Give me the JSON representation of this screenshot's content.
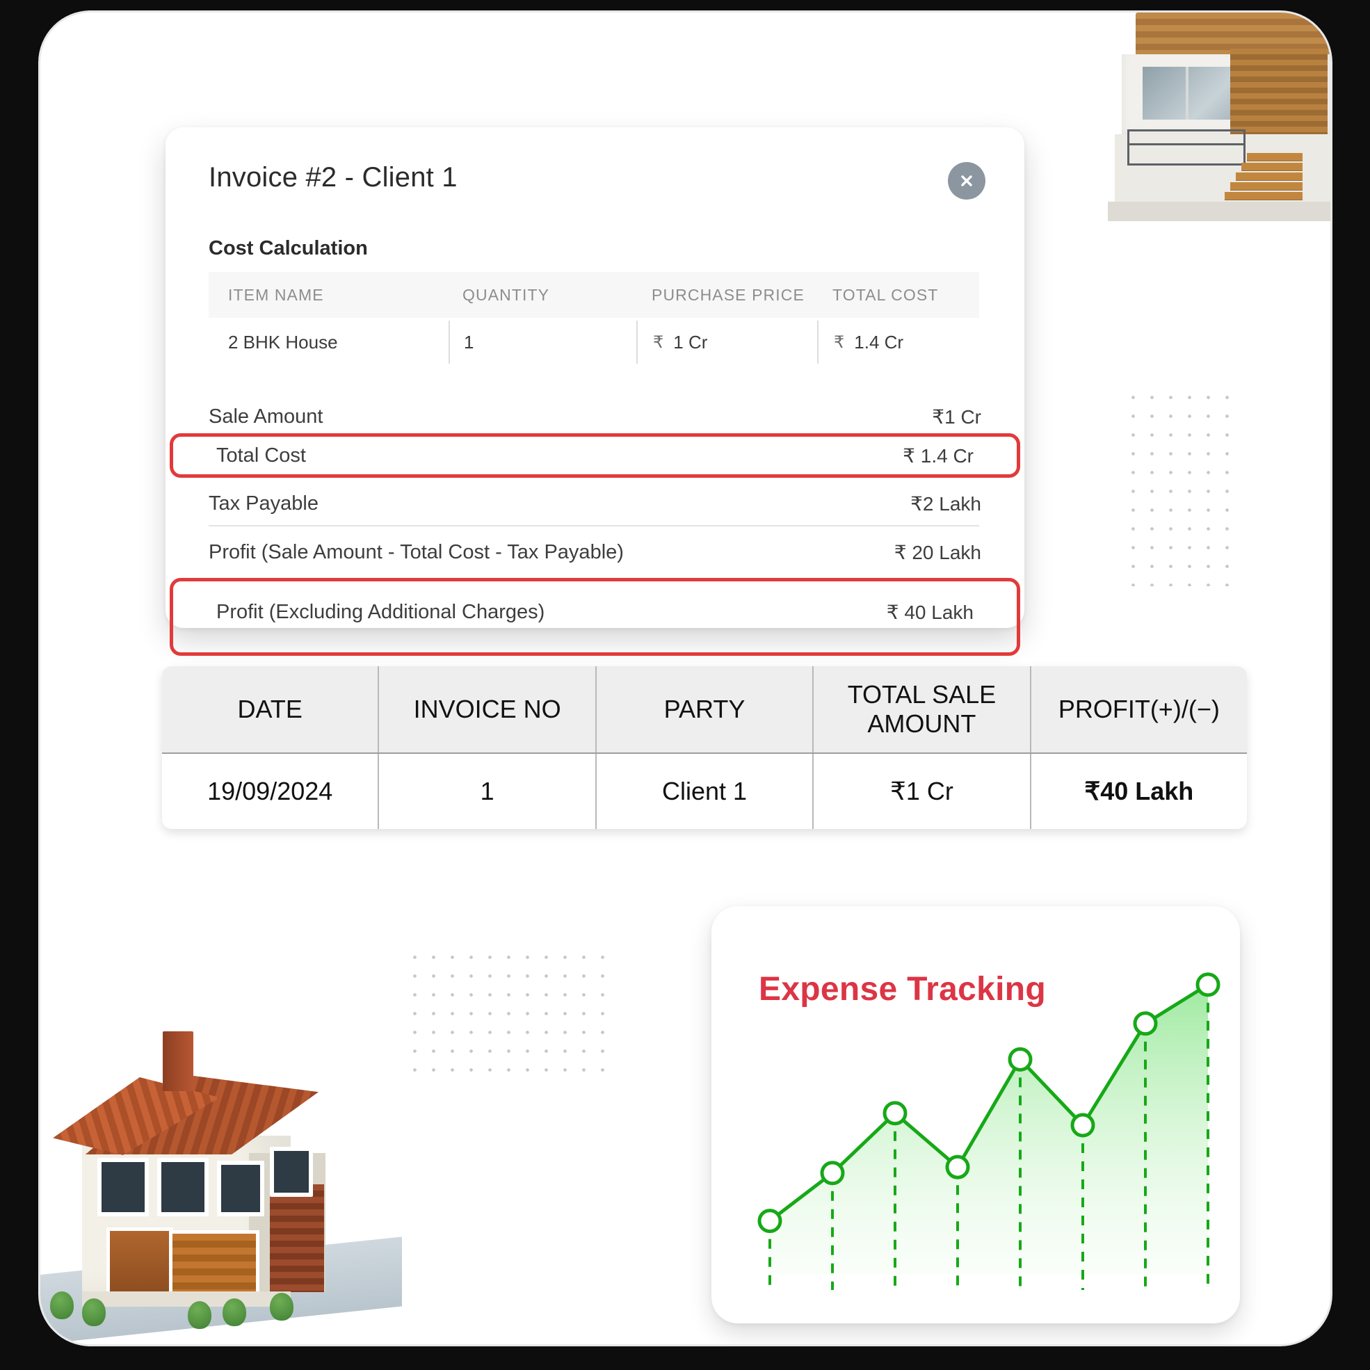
{
  "invoice": {
    "title": "Invoice #2 - Client 1",
    "close_icon": "close-icon",
    "section_label": "Cost Calculation",
    "columns": [
      "ITEM NAME",
      "QUANTITY",
      "PURCHASE PRICE",
      "TOTAL COST"
    ],
    "rows": [
      {
        "item_name": "2 BHK House",
        "quantity": "1",
        "purchase_currency": "₹",
        "purchase_price": "1 Cr",
        "total_currency": "₹",
        "total_cost": "1.4 Cr"
      }
    ],
    "summary": [
      {
        "label": "Sale Amount",
        "value": "₹1 Cr",
        "highlighted": false
      },
      {
        "label": "Total Cost",
        "value": "₹ 1.4 Cr",
        "highlighted": true
      },
      {
        "label": "Tax Payable",
        "value": "₹2 Lakh",
        "highlighted": false
      },
      {
        "label": "Profit (Sale Amount - Total Cost - Tax Payable)",
        "value": "₹ 20 Lakh",
        "highlighted": false
      },
      {
        "label": "Profit (Excluding Additional Charges)",
        "value": "₹ 40 Lakh",
        "highlighted": true
      }
    ],
    "highlight_color": "#e23a3a"
  },
  "ledger": {
    "columns": [
      "DATE",
      "INVOICE NO",
      "PARTY",
      "TOTAL SALE AMOUNT",
      "PROFIT(+)/(−)"
    ],
    "rows": [
      {
        "date": "19/09/2024",
        "invoice_no": "1",
        "party": "Client 1",
        "total_sale_amount": "₹1 Cr",
        "profit": "₹40 Lakh"
      }
    ],
    "profit_color": "#10c83c"
  },
  "chart_data": {
    "type": "line",
    "title": "Expense Tracking",
    "title_color": "#dc3545",
    "line_color": "#17a818",
    "marker_fill": "#ffffff",
    "area_fill": "#b7f0b8",
    "grid": false,
    "legend": null,
    "xlabel": "",
    "ylabel": "",
    "x": [
      1,
      2,
      3,
      4,
      5,
      6,
      7,
      8
    ],
    "values": [
      18,
      34,
      54,
      36,
      72,
      50,
      84,
      97
    ],
    "ylim": [
      0,
      100
    ],
    "xlim": [
      1,
      8
    ]
  },
  "decor": {
    "house_top": "modern-house-image",
    "house_big": "suburban-house-image",
    "dots_right": "dot-grid-pattern",
    "dots_mid": "dot-grid-pattern"
  }
}
